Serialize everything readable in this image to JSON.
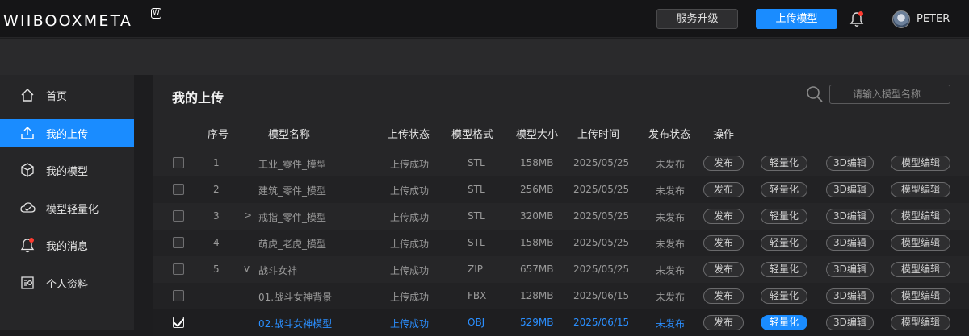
{
  "header": {
    "logo": "WIIBOOXMETA",
    "logo_mark": "W",
    "upgrade_label": "服务升级",
    "upload_label": "上传模型",
    "username": "PETER",
    "colors": {
      "accent": "#1a8cff",
      "notification_dot": "#ff3b30"
    }
  },
  "sidebar": {
    "items": [
      {
        "label": "首页",
        "icon": "home-icon",
        "active": false
      },
      {
        "label": "我的上传",
        "icon": "upload-icon",
        "active": true
      },
      {
        "label": "我的模型",
        "icon": "model-icon",
        "active": false
      },
      {
        "label": "模型轻量化",
        "icon": "cloud-check-icon",
        "active": false
      },
      {
        "label": "我的消息",
        "icon": "bell-icon",
        "active": false
      },
      {
        "label": "个人资料",
        "icon": "profile-icon",
        "active": false
      }
    ]
  },
  "main": {
    "title": "我的上传",
    "search_placeholder": "请输入模型名称",
    "columns": [
      "序号",
      "模型名称",
      "上传状态",
      "模型格式",
      "模型大小",
      "上传时间",
      "发布状态",
      "操作"
    ],
    "actions": [
      "发布",
      "轻量化",
      "3D编辑",
      "模型编辑"
    ],
    "rows": [
      {
        "index": "1",
        "name": "工业_零件_模型",
        "status": "上传成功",
        "format": "STL",
        "size": "158MB",
        "date": "2025/05/25",
        "publish": "未发布",
        "expand": "",
        "checked": false
      },
      {
        "index": "2",
        "name": "建筑_零件_模型",
        "status": "上传成功",
        "format": "STL",
        "size": "256MB",
        "date": "2025/05/25",
        "publish": "未发布",
        "expand": "",
        "checked": false
      },
      {
        "index": "3",
        "name": "戒指_零件_模型",
        "status": "上传成功",
        "format": "STL",
        "size": "320MB",
        "date": "2025/05/25",
        "publish": "未发布",
        "expand": ">",
        "checked": false
      },
      {
        "index": "4",
        "name": "萌虎_老虎_模型",
        "status": "上传成功",
        "format": "STL",
        "size": "158MB",
        "date": "2025/05/25",
        "publish": "未发布",
        "expand": "",
        "checked": false
      },
      {
        "index": "5",
        "name": "战斗女神",
        "status": "上传成功",
        "format": "ZIP",
        "size": "657MB",
        "date": "2025/05/25",
        "publish": "未发布",
        "expand": "v",
        "checked": false
      },
      {
        "index": "",
        "name": "01.战斗女神背景",
        "status": "上传成功",
        "format": "FBX",
        "size": "128MB",
        "date": "2025/06/15",
        "publish": "未发布",
        "expand": "",
        "checked": false
      },
      {
        "index": "",
        "name": "02.战斗女神模型",
        "status": "上传成功",
        "format": "OBJ",
        "size": "529MB",
        "date": "2025/06/15",
        "publish": "未发布",
        "expand": "",
        "checked": true
      }
    ]
  }
}
